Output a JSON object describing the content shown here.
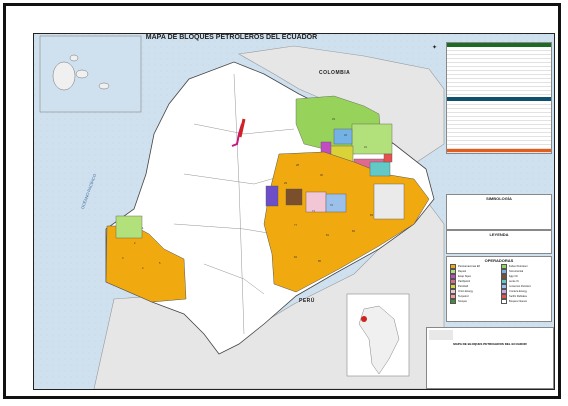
{
  "map": {
    "title": "MAPA DE BLOQUES PETROLEROS DEL ECUADOR",
    "neighbors": {
      "north": "COLOMBIA",
      "south": "PERÚ"
    },
    "ocean": "OCÉANO PACÍFICO",
    "colors": {
      "land": "#ffffff",
      "sea": "#cfe0ee",
      "neighbor": "#e4e4e4",
      "orange_blocks": "#f0a90f",
      "green_blocks": "#9ad45c",
      "magenta_line": "#c2187f",
      "purple_block": "#6b4ec8"
    },
    "block_numbers": [
      "1",
      "2",
      "3",
      "4",
      "5",
      "28",
      "29",
      "30",
      "31",
      "32",
      "33",
      "34",
      "36",
      "37",
      "38",
      "39",
      "40",
      "41",
      "42",
      "43",
      "44",
      "45",
      "46",
      "47",
      "48",
      "49",
      "60",
      "61",
      "62",
      "64",
      "66",
      "67",
      "70",
      "71",
      "72",
      "73",
      "74",
      "75",
      "76",
      "77",
      "78",
      "79",
      "81",
      "82",
      "83",
      "84",
      "85",
      "86",
      "87"
    ],
    "legend": {
      "symbology_title": "SIMBOLOGÍA",
      "locator_title": "LEYENDA",
      "operators_title": "OPERADORAS",
      "operators": [
        {
          "label": "Petroamazonas EP",
          "color": "#f0a90f"
        },
        {
          "label": "Andes Petroleum",
          "color": "#97d25a"
        },
        {
          "label": "Repsol",
          "color": "#b2e07a"
        },
        {
          "label": "Petrooriental",
          "color": "#74b2e6"
        },
        {
          "label": "Enap Sipec",
          "color": "#c14cc3"
        },
        {
          "label": "Agip Oil",
          "color": "#7b4f2c"
        },
        {
          "label": "Pacifpetrol",
          "color": "#e06a8f"
        },
        {
          "label": "Gente Oil",
          "color": "#63c9c7"
        },
        {
          "label": "Petrobell",
          "color": "#d9d239"
        },
        {
          "label": "Consorcio Petrolero",
          "color": "#9bc0ea"
        },
        {
          "label": "Orion Energy",
          "color": "#f2c6d5"
        },
        {
          "label": "Frontera Energy",
          "color": "#c9a7e6"
        },
        {
          "label": "Tecpetrol",
          "color": "#f59a9a"
        },
        {
          "label": "Pacific Rubiales",
          "color": "#e85050"
        },
        {
          "label": "Sinopec",
          "color": "#4a8b3a"
        },
        {
          "label": "Bloques Nuevos",
          "color": "#ffffff"
        }
      ]
    },
    "footer_title": "MAPA DE BLOQUES PETROLEROS DEL ECUADOR"
  }
}
